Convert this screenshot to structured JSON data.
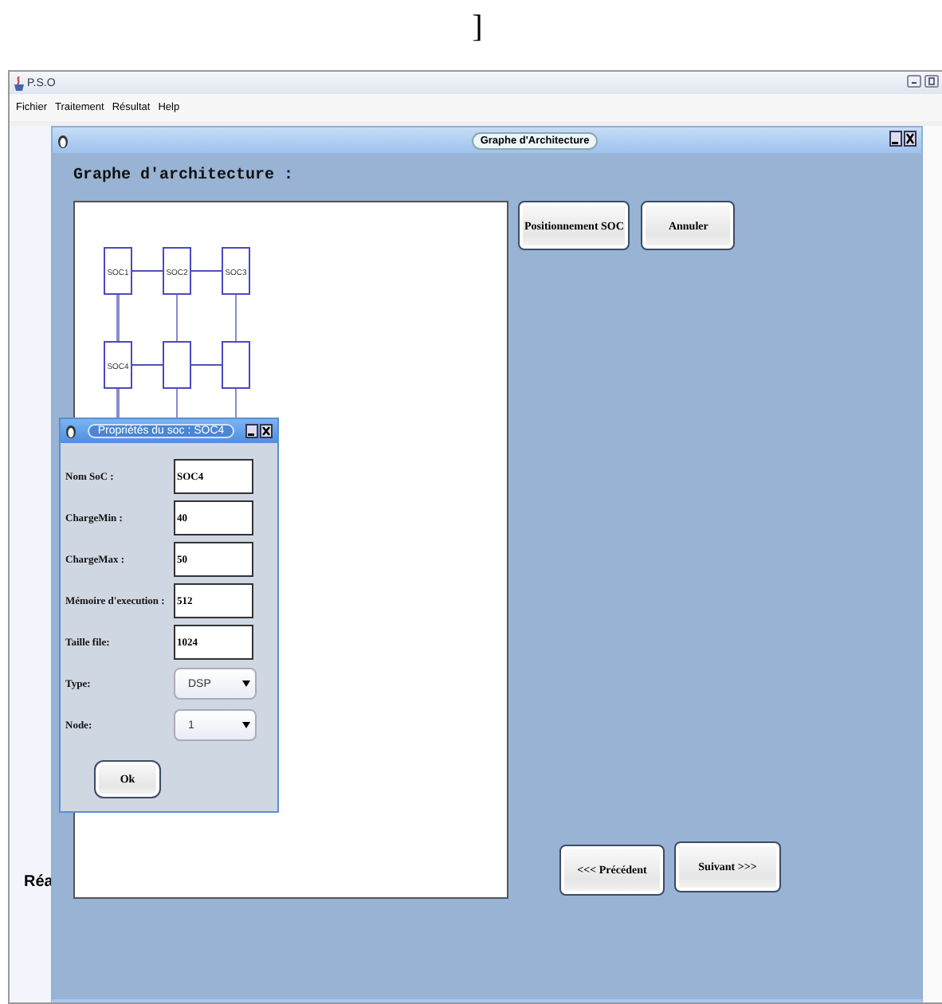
{
  "caption": "]",
  "window": {
    "title": "P.S.O"
  },
  "menu": [
    "Fichier",
    "Traitement",
    "Résultat",
    "Help"
  ],
  "side_text": "Réa",
  "frame": {
    "title": "Graphe d'Architecture",
    "heading": "Graphe d'architecture :"
  },
  "graph": {
    "rows": [
      [
        {
          "label": "SOC1"
        },
        {
          "label": "SOC2"
        },
        {
          "label": "SOC3"
        }
      ],
      [
        {
          "label": "SOC4"
        },
        {},
        {}
      ]
    ]
  },
  "top_buttons": [
    "Positionnement SOC",
    "Annuler"
  ],
  "bottom_buttons": [
    "<<< Précédent",
    "Suivant >>>"
  ],
  "dialog": {
    "title": "Propriétés du soc : SOC4",
    "ok": "Ok",
    "fields": [
      {
        "label": "Nom SoC :",
        "value": "SOC4",
        "kind": "text"
      },
      {
        "label": "ChargeMin :",
        "value": "40",
        "kind": "text"
      },
      {
        "label": "ChargeMax :",
        "value": "50",
        "kind": "text"
      },
      {
        "label": "Mémoire d'execution :",
        "value": "512",
        "kind": "text"
      },
      {
        "label": "Taille file:",
        "value": "1024",
        "kind": "text"
      },
      {
        "label": "Type:",
        "value": "DSP",
        "kind": "select"
      },
      {
        "label": "Node:",
        "value": "1",
        "kind": "select"
      }
    ]
  }
}
